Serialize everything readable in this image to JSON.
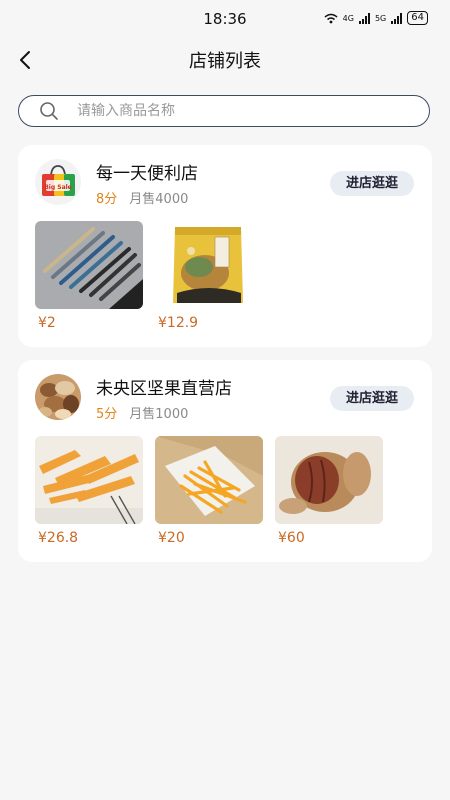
{
  "status": {
    "time": "18:36",
    "network_a": "4G",
    "network_b": "5G",
    "battery": "64"
  },
  "header": {
    "title": "店铺列表"
  },
  "search": {
    "placeholder": "请输入商品名称"
  },
  "stores": [
    {
      "name": "每一天便利店",
      "rating": "8分",
      "sales": "月售4000",
      "enter_label": "进店逛逛",
      "logo_text": "Big Sale",
      "products": [
        {
          "image": "pens",
          "price": "¥2"
        },
        {
          "image": "snack-bag",
          "price": "¥12.9"
        }
      ]
    },
    {
      "name": "未央区坚果直营店",
      "rating": "5分",
      "sales": "月售1000",
      "enter_label": "进店逛逛",
      "products": [
        {
          "image": "sweet-potato-chips",
          "price": "¥26.8"
        },
        {
          "image": "french-fries",
          "price": "¥20"
        },
        {
          "image": "pecans",
          "price": "¥60"
        }
      ]
    }
  ],
  "colors": {
    "accent": "#e0851a",
    "price": "#c96a25",
    "button_bg": "#e8ecf3",
    "search_border": "#3d4a63"
  }
}
